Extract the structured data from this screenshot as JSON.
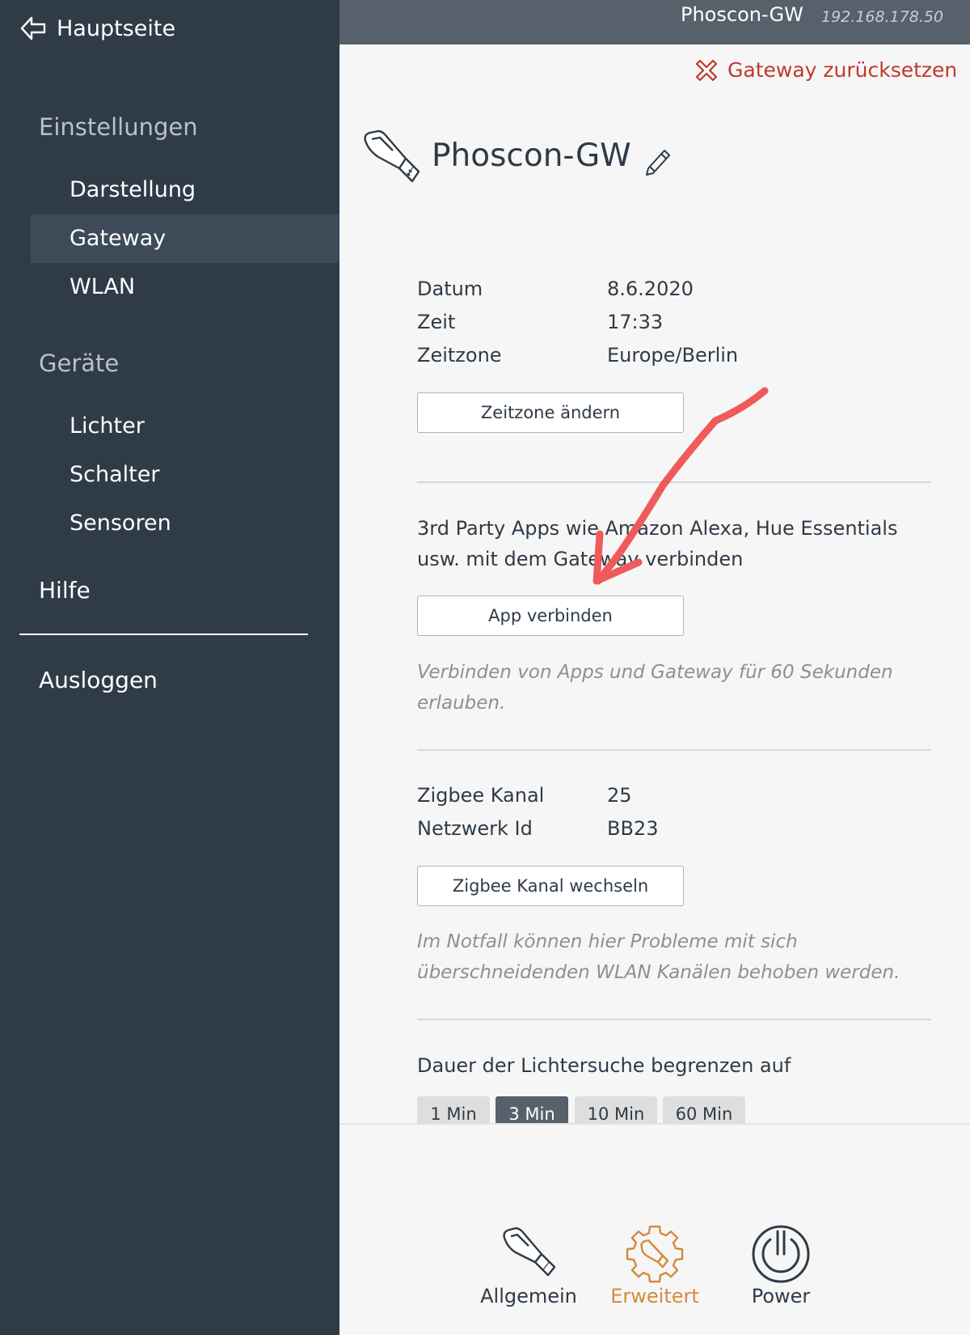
{
  "sidebar": {
    "back_label": "Hauptseite",
    "section_settings": "Einstellungen",
    "settings_items": [
      "Darstellung",
      "Gateway",
      "WLAN"
    ],
    "active_item": "Gateway",
    "section_devices": "Geräte",
    "device_items": [
      "Lichter",
      "Schalter",
      "Sensoren"
    ],
    "help_label": "Hilfe",
    "logout_label": "Ausloggen"
  },
  "header": {
    "gateway_name": "Phoscon-GW",
    "gateway_ip": "192.168.178.50"
  },
  "main": {
    "reset_label": "Gateway zurücksetzen",
    "title": "Phoscon-GW",
    "time_info": {
      "date_label": "Datum",
      "date_value": "8.6.2020",
      "time_label": "Zeit",
      "time_value": "17:33",
      "tz_label": "Zeitzone",
      "tz_value": "Europe/Berlin",
      "change_tz_button": "Zeitzone ändern"
    },
    "apps": {
      "description": "3rd Party Apps wie Amazon Alexa, Hue Essentials usw. mit dem Gateway verbinden",
      "connect_button": "App verbinden",
      "hint": "Verbinden von Apps und Gateway für 60 Sekunden erlauben."
    },
    "zigbee": {
      "channel_label": "Zigbee Kanal",
      "channel_value": "25",
      "network_label": "Netzwerk Id",
      "network_value": "BB23",
      "change_button": "Zigbee Kanal wechseln",
      "hint": "Im Notfall können hier Probleme mit sich überschneidenden WLAN Kanälen behoben werden."
    },
    "search": {
      "label": "Dauer der Lichtersuche begrenzen auf",
      "options": [
        "1 Min",
        "3 Min",
        "10 Min",
        "60 Min"
      ],
      "selected": "3 Min"
    }
  },
  "bottom_tabs": {
    "general": "Allgemein",
    "advanced": "Erweitert",
    "power": "Power",
    "active": "Erweitert"
  },
  "colors": {
    "sidebar_bg": "#2f3b47",
    "header_bg": "#56616c",
    "accent_orange": "#d58a3c",
    "danger_red": "#c0392b",
    "annotation_arrow": "#f05a5a"
  }
}
